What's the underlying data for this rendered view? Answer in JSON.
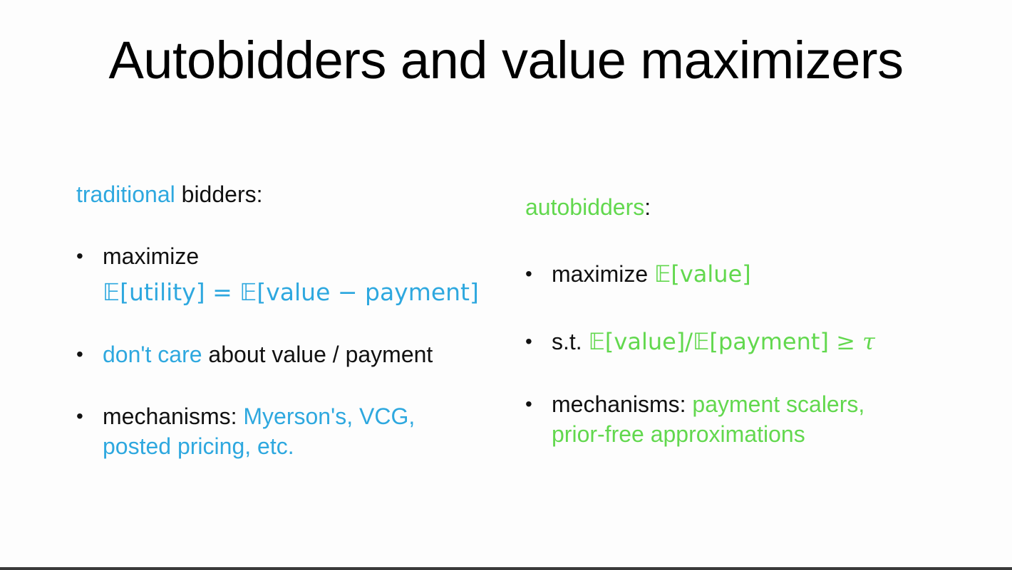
{
  "slide": {
    "title": "Autobidders and value maximizers",
    "colors": {
      "traditional_accent": "#2ea8df",
      "autobidder_accent": "#62d84e",
      "text": "#111111"
    }
  },
  "left": {
    "heading_accent": "traditional",
    "heading_rest": " bidders:",
    "bullets": {
      "b1_line1": "maximize",
      "b1_formula": "𝔼[utility] = 𝔼[value − payment]",
      "b2_accent": "don't care",
      "b2_rest": " about value / payment",
      "b3_prefix": "mechanisms: ",
      "b3_accent_line1": "Myerson's, VCG,",
      "b3_accent_line2": "posted pricing, etc."
    }
  },
  "right": {
    "heading_accent": "autobidders",
    "heading_rest": ":",
    "bullets": {
      "b1_prefix": "maximize ",
      "b1_formula": "𝔼[value]",
      "b2_prefix": "s.t. ",
      "b2_formula": "𝔼[value]/𝔼[payment]",
      "b2_relation": " ≥ ",
      "b2_symbol": "τ",
      "b3_prefix": "mechanisms: ",
      "b3_accent_line1": "payment scalers,",
      "b3_accent_line2": "prior-free approximations"
    }
  },
  "bullet_glyph": "•"
}
